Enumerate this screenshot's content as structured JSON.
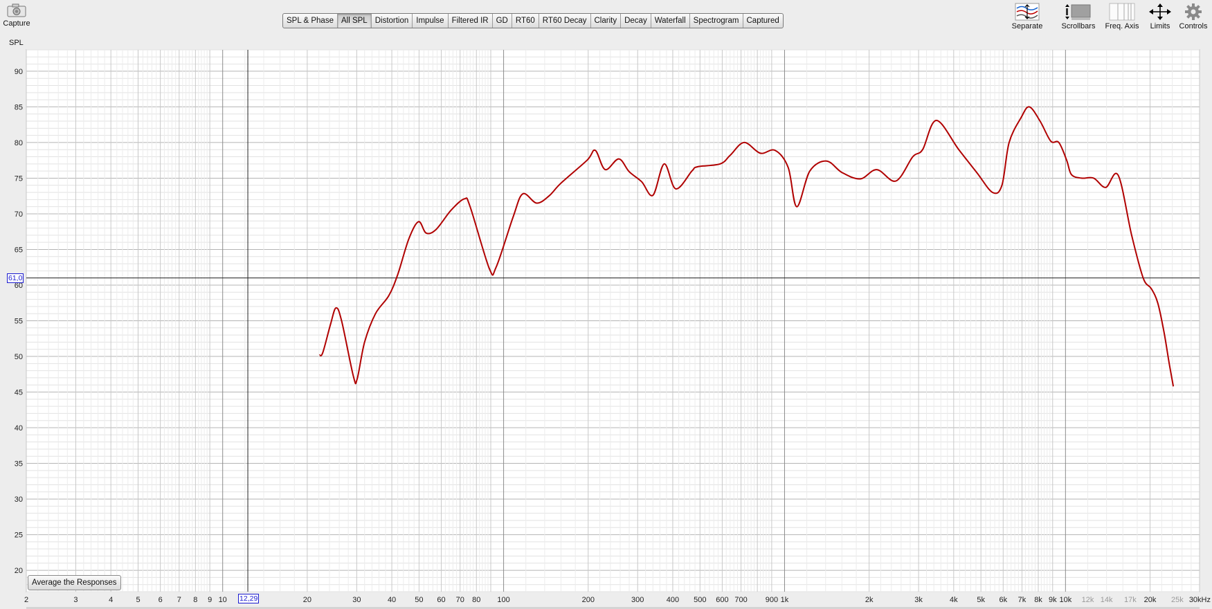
{
  "capture": {
    "label": "Capture"
  },
  "toolbar": {
    "tabs": [
      "SPL & Phase",
      "All SPL",
      "Distortion",
      "Impulse",
      "Filtered IR",
      "GD",
      "RT60",
      "RT60 Decay",
      "Clarity",
      "Decay",
      "Waterfall",
      "Spectrogram",
      "Captured"
    ],
    "active": "All SPL"
  },
  "right_tools": {
    "separate": "Separate",
    "scrollbars": "Scrollbars",
    "freq_axis": "Freq. Axis",
    "limits": "Limits",
    "controls": "Controls"
  },
  "y_axis_label": "SPL",
  "average_button": "Average the Responses",
  "cursor": {
    "y_readout": "61,0",
    "x_readout": "12,29",
    "freq_hz": 12.29,
    "spl_db": 61.0
  },
  "colors": {
    "trace": "#b00000",
    "background": "#ededed",
    "plot_bg": "#ffffff",
    "cursor_box": "#1a1ad0"
  },
  "chart_data": {
    "type": "line",
    "x_scale": "log",
    "xlim": [
      2,
      30000
    ],
    "ylim": [
      17,
      93
    ],
    "y_ticks": [
      20,
      25,
      30,
      35,
      40,
      45,
      50,
      55,
      60,
      65,
      70,
      75,
      80,
      85,
      90
    ],
    "x_tick_labels": [
      {
        "f": 2,
        "label": "2"
      },
      {
        "f": 3,
        "label": "3"
      },
      {
        "f": 4,
        "label": "4"
      },
      {
        "f": 5,
        "label": "5"
      },
      {
        "f": 6,
        "label": "6"
      },
      {
        "f": 7,
        "label": "7"
      },
      {
        "f": 8,
        "label": "8"
      },
      {
        "f": 9,
        "label": "9"
      },
      {
        "f": 10,
        "label": "10"
      },
      {
        "f": 20,
        "label": "20"
      },
      {
        "f": 30,
        "label": "30"
      },
      {
        "f": 40,
        "label": "40"
      },
      {
        "f": 50,
        "label": "50"
      },
      {
        "f": 60,
        "label": "60"
      },
      {
        "f": 70,
        "label": "70"
      },
      {
        "f": 80,
        "label": "80"
      },
      {
        "f": 100,
        "label": "100"
      },
      {
        "f": 200,
        "label": "200"
      },
      {
        "f": 300,
        "label": "300"
      },
      {
        "f": 400,
        "label": "400"
      },
      {
        "f": 500,
        "label": "500"
      },
      {
        "f": 600,
        "label": "600"
      },
      {
        "f": 700,
        "label": "700"
      },
      {
        "f": 900,
        "label": "900"
      },
      {
        "f": 1000,
        "label": "1k"
      },
      {
        "f": 2000,
        "label": "2k"
      },
      {
        "f": 3000,
        "label": "3k"
      },
      {
        "f": 4000,
        "label": "4k"
      },
      {
        "f": 5000,
        "label": "5k"
      },
      {
        "f": 6000,
        "label": "6k"
      },
      {
        "f": 7000,
        "label": "7k"
      },
      {
        "f": 8000,
        "label": "8k"
      },
      {
        "f": 9000,
        "label": "9k"
      },
      {
        "f": 10000,
        "label": "10k"
      },
      {
        "f": 12000,
        "label": "12k"
      },
      {
        "f": 14000,
        "label": "14k"
      },
      {
        "f": 17000,
        "label": "17k"
      },
      {
        "f": 20000,
        "label": "20k"
      },
      {
        "f": 25000,
        "label": "25k"
      },
      {
        "f": 30000,
        "label": "30kHz"
      }
    ],
    "series": [
      {
        "x": [
          22.1,
          22.7,
          24.2,
          25.3,
          26.5,
          29.2,
          30.1,
          32.0,
          35.0,
          39.0,
          42.0,
          46.0,
          49.8,
          53.0,
          57.5,
          65.0,
          72.5,
          76.0,
          89.0,
          94.0,
          108.0,
          117.0,
          131.0,
          145.0,
          160.0,
          198.0,
          212.0,
          230.0,
          257.0,
          280.0,
          310.0,
          340.0,
          373.0,
          410.0,
          468.0,
          490.0,
          590.0,
          640.0,
          718.0,
          820.0,
          925.0,
          1030.0,
          1105.0,
          1230.0,
          1410.0,
          1600.0,
          1860.0,
          2130.0,
          2490.0,
          2860.0,
          3100.0,
          3470.0,
          4170.0,
          4830.0,
          5500.0,
          5940.0,
          6300.0,
          6950.0,
          7430.0,
          8120.0,
          8860.0,
          9470.0,
          10100.0,
          10500.0,
          11400.0,
          12600.0,
          13900.0,
          15400.0,
          17200.0,
          18900.0,
          20200.0,
          21300.0,
          22400.0,
          23400.0,
          24200.0
        ],
        "y": [
          50.2,
          50.5,
          54.5,
          56.8,
          55.0,
          47.2,
          46.8,
          52.0,
          56.0,
          58.5,
          61.5,
          66.5,
          68.9,
          67.3,
          67.8,
          70.5,
          72.1,
          71.0,
          62.3,
          62.5,
          69.5,
          72.8,
          71.5,
          72.5,
          74.3,
          77.5,
          78.9,
          76.2,
          77.7,
          75.9,
          74.5,
          72.6,
          77.0,
          73.5,
          76.0,
          76.6,
          77.0,
          78.2,
          80.0,
          78.5,
          78.9,
          76.5,
          71.0,
          76.0,
          77.4,
          75.8,
          74.9,
          76.2,
          74.6,
          78.0,
          79.0,
          83.1,
          79.0,
          75.8,
          73.0,
          74.0,
          80.0,
          83.5,
          85.0,
          83.0,
          80.2,
          80.0,
          77.5,
          75.5,
          75.0,
          75.0,
          73.7,
          75.4,
          67.0,
          61.0,
          59.5,
          57.5,
          53.5,
          49.0,
          45.8
        ]
      }
    ]
  }
}
